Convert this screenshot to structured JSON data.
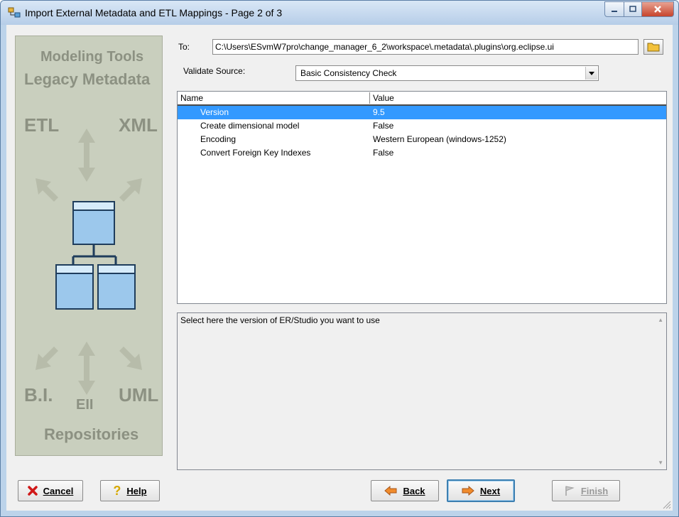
{
  "window": {
    "title": "Import External Metadata and ETL Mappings - Page 2 of 3"
  },
  "side_panel": {
    "labels": {
      "modeling": "Modeling Tools",
      "legacy": "Legacy Metadata",
      "etl": "ETL",
      "xml": "XML",
      "bi": "B.I.",
      "uml": "UML",
      "eii": "EII",
      "repos": "Repositories"
    }
  },
  "form": {
    "to_label": "To:",
    "to_value": "C:\\Users\\ESvmW7pro\\change_manager_6_2\\workspace\\.metadata\\.plugins\\org.eclipse.ui",
    "validate_label": "Validate Source:",
    "validate_value": "Basic Consistency Check"
  },
  "properties": {
    "columns": [
      "Name",
      "Value"
    ],
    "rows": [
      {
        "name": "Version",
        "value": "9.5",
        "selected": true
      },
      {
        "name": "Create dimensional model",
        "value": "False"
      },
      {
        "name": "Encoding",
        "value": "Western European (windows-1252)"
      },
      {
        "name": "Convert Foreign Key Indexes",
        "value": "False"
      }
    ]
  },
  "description": "Select here the version of ER/Studio you want to use",
  "buttons": {
    "cancel": "Cancel",
    "help": "Help",
    "back": "Back",
    "next": "Next",
    "finish": "Finish"
  },
  "colors": {
    "selection": "#3399ff",
    "accent": "#3c7fb1"
  }
}
